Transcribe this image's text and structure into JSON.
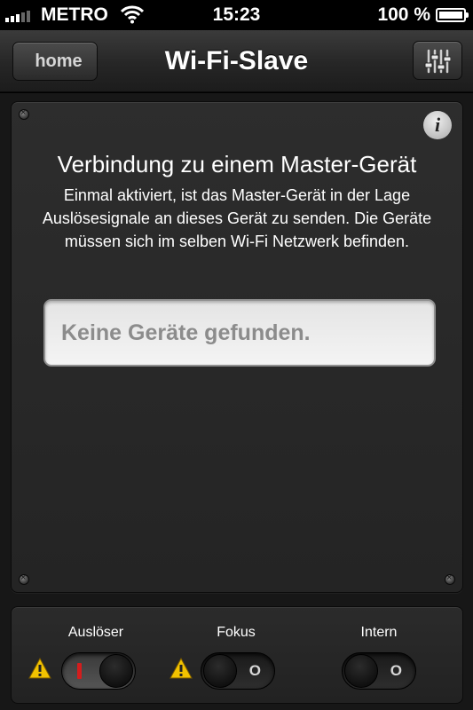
{
  "status_bar": {
    "carrier": "METRO",
    "time": "15:23",
    "battery_percent": "100 %",
    "battery_level": 1.0,
    "signal_bars": 3
  },
  "nav": {
    "back_label": "home",
    "title": "Wi-Fi-Slave",
    "settings_icon": "sliders-icon"
  },
  "panel": {
    "info_icon": "i",
    "title": "Verbindung zu einem Master-Gerät",
    "description": "Einmal aktiviert, ist das Master-Gerät in der Lage Auslösesignale an dieses Gerät zu senden. Die Geräte müssen sich im selben Wi-Fi Netzwerk befinden.",
    "device_list_text": "Keine Geräte gefunden."
  },
  "controls": [
    {
      "label": "Auslöser",
      "state": "on",
      "mark": "I",
      "warning": true
    },
    {
      "label": "Fokus",
      "state": "off",
      "mark": "O",
      "warning": true
    },
    {
      "label": "Intern",
      "state": "off",
      "mark": "O",
      "warning": false
    }
  ],
  "colors": {
    "on_indicator": "#d31d1d",
    "warning": "#f2c200"
  }
}
